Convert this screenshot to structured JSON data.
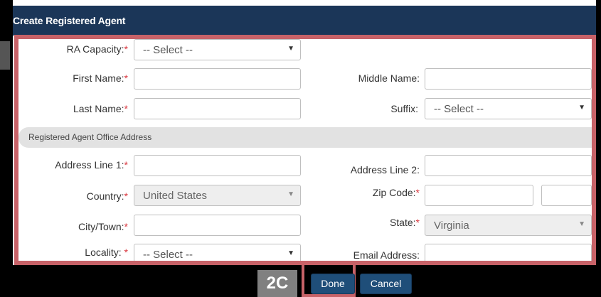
{
  "dialog": {
    "title": "Create Registered Agent"
  },
  "form": {
    "ra_capacity": {
      "label": "RA Capacity:",
      "required": "*",
      "value": "-- Select --"
    },
    "first_name": {
      "label": "First Name:",
      "required": "*",
      "value": ""
    },
    "middle_name": {
      "label": "Middle Name:",
      "value": ""
    },
    "last_name": {
      "label": "Last Name:",
      "required": "*",
      "value": ""
    },
    "suffix": {
      "label": "Suffix:",
      "value": "-- Select --"
    },
    "section_title": "Registered Agent Office Address",
    "address_line_1": {
      "label": "Address Line 1:",
      "required": "*",
      "value": ""
    },
    "address_line_2": {
      "label": "Address Line 2:",
      "value": ""
    },
    "country": {
      "label": "Country:",
      "required": "*",
      "value": "United States"
    },
    "zip_code": {
      "label": "Zip Code:",
      "required": "*",
      "value": "",
      "extension": ""
    },
    "city": {
      "label": "City/Town:",
      "required": "*",
      "value": ""
    },
    "state": {
      "label": "State:",
      "required": "*",
      "value": "Virginia"
    },
    "locality": {
      "label": "Locality: ",
      "required": "*",
      "value": "-- Select --"
    },
    "email": {
      "label": "Email Address:",
      "value": ""
    }
  },
  "footer": {
    "done_label": "Done",
    "cancel_label": "Cancel"
  },
  "annotation": {
    "step": "2C"
  },
  "colors": {
    "header": "#1b3658",
    "highlight": "#c76268",
    "button": "#1f4e79",
    "required": "#d9363e"
  },
  "icons": {
    "dropdown": "caret-down-icon"
  }
}
